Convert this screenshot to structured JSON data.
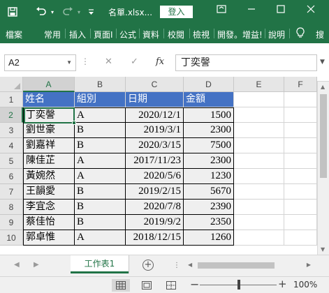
{
  "titlebar": {
    "filename": "名單.xlsx...",
    "login_label": "登入",
    "save_icon": "save-icon",
    "undo_icon": "undo-icon",
    "redo_icon": "redo-icon",
    "customize_icon": "customize-quick-access-icon",
    "restore_icon": "ribbon-display-options-icon",
    "minimize_icon": "minimize-icon",
    "maximize_icon": "maximize-icon",
    "close_icon": "close-icon"
  },
  "ribbon": {
    "tabs": [
      "檔案",
      "常用",
      "插入",
      "頁面I",
      "公式",
      "資料",
      "校閱",
      "檢視",
      "開發。",
      "增益!",
      "說明",
      "💡",
      "搜"
    ]
  },
  "formula_bar": {
    "name_box": "A2",
    "cancel": "✕",
    "enter": "✓",
    "fx": "fx",
    "content": "丁奕謦"
  },
  "columns": [
    "A",
    "B",
    "C",
    "D",
    "E",
    "F"
  ],
  "rows": [
    "1",
    "2",
    "3",
    "4",
    "5",
    "6",
    "7",
    "8",
    "9",
    "10"
  ],
  "table": {
    "headers": [
      "姓名",
      "組別",
      "日期",
      "金額"
    ],
    "rows": [
      [
        "丁奕謦",
        "A",
        "2020/12/1",
        "1500"
      ],
      [
        "劉世豪",
        "B",
        "2019/3/1",
        "2300"
      ],
      [
        "劉嘉祥",
        "B",
        "2020/3/15",
        "7500"
      ],
      [
        "陳佳芷",
        "A",
        "2017/11/23",
        "2300"
      ],
      [
        "黃婉然",
        "A",
        "2020/5/6",
        "1230"
      ],
      [
        "王韻愛",
        "B",
        "2019/2/15",
        "5670"
      ],
      [
        "李宜念",
        "B",
        "2020/7/8",
        "2390"
      ],
      [
        "蔡佳怡",
        "B",
        "2019/9/2",
        "2350"
      ],
      [
        "郭卓惟",
        "A",
        "2018/12/15",
        "1260"
      ]
    ]
  },
  "sheets": {
    "active": "工作表1",
    "add_icon": "add-sheet-icon"
  },
  "statusbar": {
    "zoom": "100%",
    "zoom_minus": "−",
    "zoom_plus": "+"
  },
  "colors": {
    "excel_green": "#217346",
    "header_fill": "#4472c4",
    "data_fill": "#efefef"
  }
}
